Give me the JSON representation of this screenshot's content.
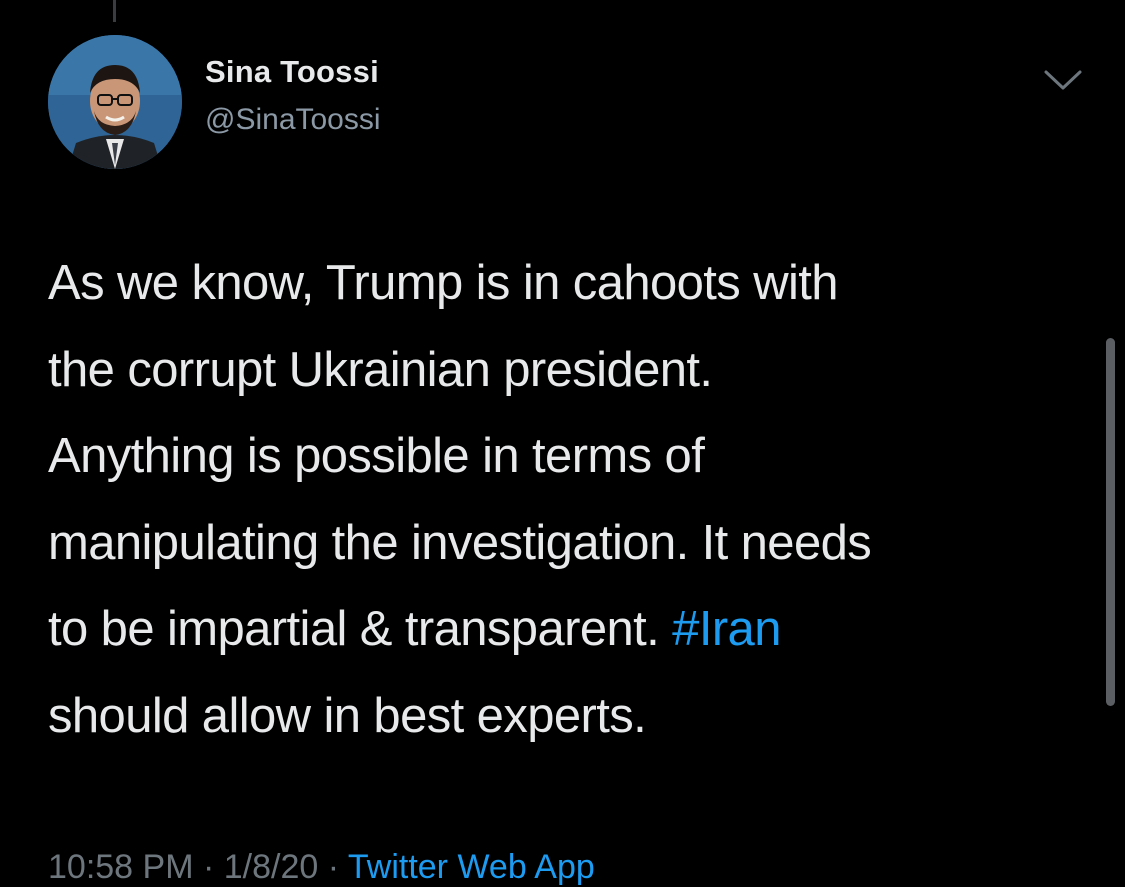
{
  "author": {
    "display_name": "Sina Toossi",
    "handle": "@SinaToossi",
    "avatar_icon": "profile-photo"
  },
  "tweet": {
    "lines": [
      "As we know, Trump is in cahoots with",
      "the corrupt Ukrainian president.",
      "Anything is possible in terms of",
      "manipulating the investigation. It needs"
    ],
    "line5_text": "to be impartial & transparent. ",
    "hashtag": "#Iran",
    "line6": "should allow in best experts."
  },
  "footer": {
    "meta": "10:58 PM · 1/8/20 · ",
    "source": "Twitter Web App"
  },
  "icons": {
    "menu": "chevron-down-icon"
  },
  "colors": {
    "background": "#000000",
    "text": "#e7e9ea",
    "secondary_text": "#8b98a5",
    "link": "#1d9bf0"
  }
}
